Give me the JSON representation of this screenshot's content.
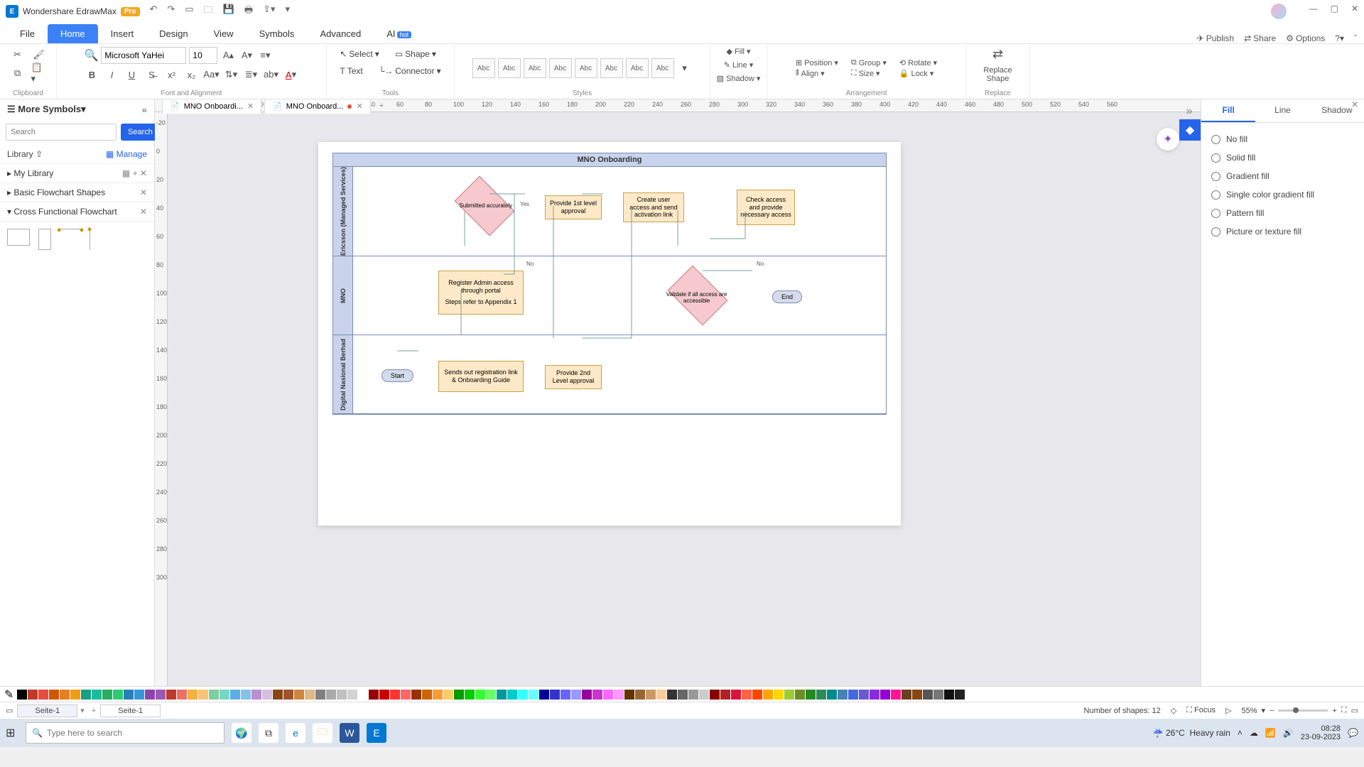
{
  "app": {
    "title": "Wondershare EdrawMax",
    "badge": "Pro"
  },
  "menu": {
    "tabs": [
      "File",
      "Home",
      "Insert",
      "Design",
      "View",
      "Symbols",
      "Advanced",
      "AI"
    ],
    "active": "Home",
    "right": {
      "publish": "Publish",
      "share": "Share",
      "options": "Options"
    }
  },
  "ribbon": {
    "clipboard": "Clipboard",
    "font": {
      "name": "Microsoft YaHei",
      "size": "10",
      "group": "Font and Alignment"
    },
    "tools": {
      "select": "Select",
      "shape": "Shape",
      "text": "Text",
      "connector": "Connector",
      "group": "Tools"
    },
    "styles": {
      "label": "Abc",
      "group": "Styles"
    },
    "fill": "Fill",
    "line": "Line",
    "shadow": "Shadow",
    "arrangement": {
      "position": "Position",
      "align": "Align",
      "group": "Group",
      "size": "Size",
      "rotate": "Rotate",
      "lock": "Lock",
      "label": "Arrangement"
    },
    "replace": {
      "shape": "Replace Shape",
      "label": "Replace"
    }
  },
  "doctabs": {
    "t1": "MNO Onboardi...",
    "t2": "MNO Onboard..."
  },
  "left": {
    "header": "More Symbols",
    "search_placeholder": "Search",
    "search_btn": "Search",
    "library": "Library",
    "manage": "Manage",
    "mylibrary": "My Library",
    "sec1": "Basic Flowchart Shapes",
    "sec2": "Cross Functional Flowchart"
  },
  "diagram": {
    "title": "MNO Onboarding",
    "lanes": [
      "Ericsson (Managed Services)",
      "MNO",
      "Digital Nasional Berhad"
    ],
    "nodes": {
      "submitted": "Submitted accurately",
      "approve1": "Provide 1st level approval",
      "create": "Create user access and send activation link",
      "check": "Check access and provide necessary access",
      "register": "Register Admin access through portal",
      "steps": "Steps refer to Appendix 1",
      "validate": "Validate if all access are accessible",
      "end": "End",
      "sends": "Sends out registration link & Onboarding Guide",
      "approve2": "Provide 2nd Level approval",
      "start": "Start",
      "yes": "Yes",
      "no": "No"
    }
  },
  "right": {
    "tabs": [
      "Fill",
      "Line",
      "Shadow"
    ],
    "active": "Fill",
    "opts": [
      "No fill",
      "Solid fill",
      "Gradient fill",
      "Single color gradient fill",
      "Pattern fill",
      "Picture or texture fill"
    ]
  },
  "colors": [
    "#000000",
    "#c0392b",
    "#e74c3c",
    "#d35400",
    "#e67e22",
    "#f39c12",
    "#16a085",
    "#1abc9c",
    "#27ae60",
    "#2ecc71",
    "#2980b9",
    "#3498db",
    "#8e44ad",
    "#9b59b6",
    "#c0392b",
    "#ec7063",
    "#f5b041",
    "#f8c471",
    "#7dcea0",
    "#76d7c4",
    "#5dade2",
    "#85c1e9",
    "#bb8fce",
    "#d7bde2",
    "#8b4513",
    "#a0522d",
    "#cd853f",
    "#deb887",
    "#808080",
    "#a9a9a9",
    "#c0c0c0",
    "#d3d3d3",
    "#ffffff",
    "#900",
    "#c00",
    "#f33",
    "#f66",
    "#930",
    "#c60",
    "#f93",
    "#fc6",
    "#090",
    "#0c0",
    "#3f3",
    "#6f6",
    "#099",
    "#0cc",
    "#3ff",
    "#6ff",
    "#009",
    "#33c",
    "#66f",
    "#99f",
    "#909",
    "#c3c",
    "#f6f",
    "#f9f",
    "#630",
    "#963",
    "#c96",
    "#fc9",
    "#333",
    "#666",
    "#999",
    "#ccc",
    "#8b0000",
    "#b22222",
    "#dc143c",
    "#ff6347",
    "#ff4500",
    "#ffa500",
    "#ffd700",
    "#9acd32",
    "#6b8e23",
    "#228b22",
    "#2e8b57",
    "#008b8b",
    "#4682b4",
    "#4169e1",
    "#6a5acd",
    "#8a2be2",
    "#9400d3",
    "#ff1493",
    "#654321",
    "#8b4513",
    "#555",
    "#777",
    "#111",
    "#222"
  ],
  "pagebar": {
    "page": "Seite-1",
    "shapes": "Number of shapes: 12",
    "focus": "Focus",
    "zoom": "55%"
  },
  "taskbar": {
    "search": "Type here to search",
    "weather_temp": "26°C",
    "weather_cond": "Heavy rain",
    "time": "08:28",
    "date": "23-09-2023"
  }
}
